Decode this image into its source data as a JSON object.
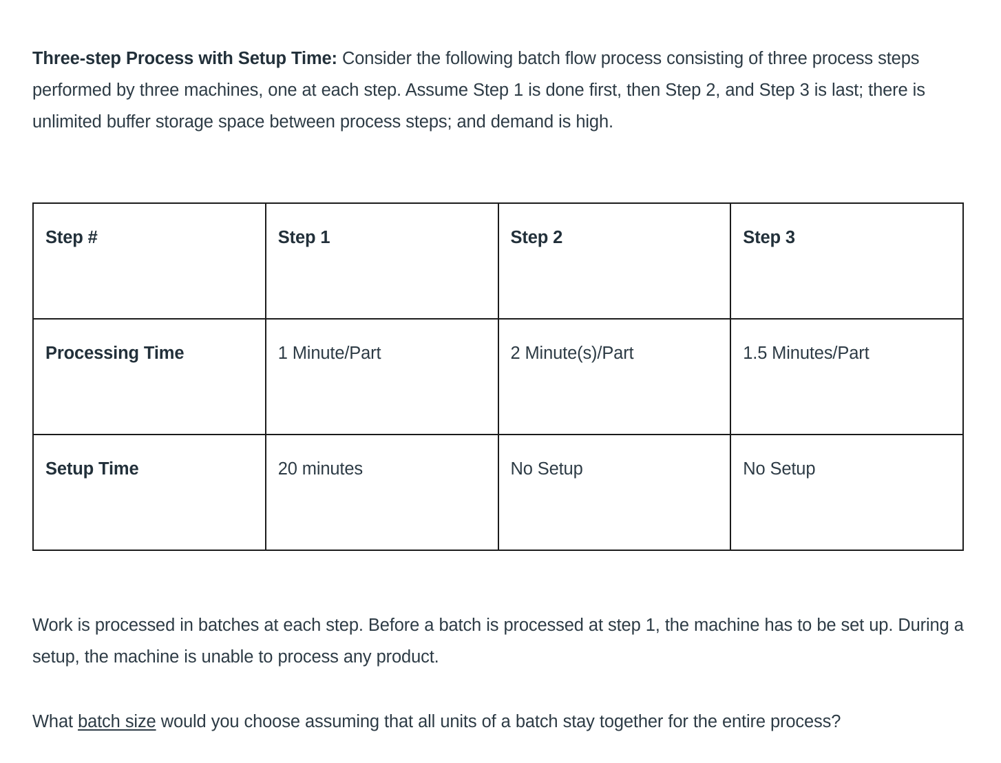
{
  "intro": {
    "lead_in": "Three-step Process with Setup Time:",
    "body": " Consider the following batch flow process consisting of three process steps performed by three machines, one at each step. Assume Step 1 is done first, then Step 2, and Step 3 is last; there is unlimited buffer storage space between process steps; and demand is high."
  },
  "table": {
    "columns": [
      "Step #",
      "Step 1",
      "Step 2",
      "Step 3"
    ],
    "rows": [
      {
        "label": "Processing Time",
        "values": [
          "1 Minute/Part",
          "2 Minute(s)/Part",
          "1.5 Minutes/Part"
        ]
      },
      {
        "label": "Setup Time",
        "values": [
          "20 minutes",
          "No Setup",
          "No Setup"
        ]
      }
    ]
  },
  "batch_paragraph": {
    "text": "Work is processed in batches at each step. Before a batch is processed at step 1, the machine has to be set up. During a setup, the machine is unable to process any product."
  },
  "question": {
    "before": "What ",
    "emphasis": "batch size",
    "after": " would you choose assuming that all units of a batch stay together for the entire process?"
  },
  "colors": {
    "text": "#2d3b45",
    "heading": "#22303a",
    "border": "#1b1b1b",
    "background": "#ffffff"
  }
}
